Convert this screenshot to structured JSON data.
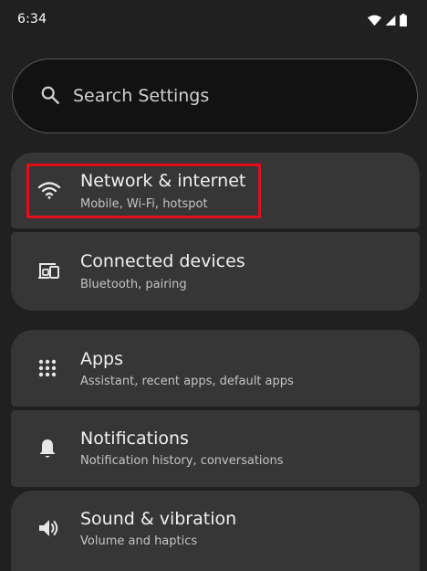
{
  "status_bar": {
    "time": "6:34",
    "icons": [
      "wifi-icon",
      "cell-signal-icon",
      "battery-icon"
    ]
  },
  "search": {
    "placeholder": "Search Settings",
    "icon": "search-icon"
  },
  "settings": [
    {
      "title": "Network & internet",
      "subtitle": "Mobile, Wi-Fi, hotspot",
      "icon": "wifi-icon",
      "highlighted": true
    },
    {
      "title": "Connected devices",
      "subtitle": "Bluetooth, pairing",
      "icon": "connected-devices-icon"
    },
    {
      "title": "Apps",
      "subtitle": "Assistant, recent apps, default apps",
      "icon": "apps-grid-icon"
    },
    {
      "title": "Notifications",
      "subtitle": "Notification history, conversations",
      "icon": "bell-icon"
    },
    {
      "title": "Sound & vibration",
      "subtitle": "Volume and haptics",
      "icon": "speaker-icon"
    }
  ],
  "colors": {
    "background": "#202020",
    "card": "#363636",
    "highlight_border": "#e0101a"
  }
}
